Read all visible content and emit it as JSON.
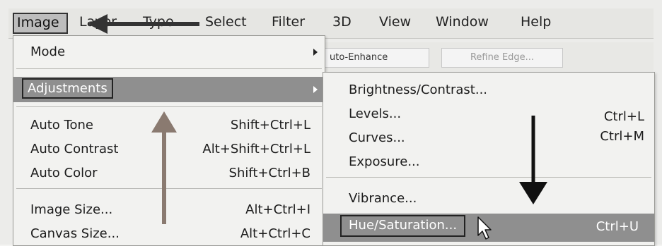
{
  "menubar": {
    "items": [
      "Image",
      "Layer",
      "Type",
      "Select",
      "Filter",
      "3D",
      "View",
      "Window",
      "Help"
    ]
  },
  "toolbar": {
    "auto_enhance": "uto-Enhance",
    "refine_edge": "Refine Edge..."
  },
  "image_menu": {
    "mode": "Mode",
    "adjustments": "Adjustments",
    "auto_tone": {
      "label": "Auto Tone",
      "shortcut": "Shift+Ctrl+L"
    },
    "auto_contrast": {
      "label": "Auto Contrast",
      "shortcut": "Alt+Shift+Ctrl+L"
    },
    "auto_color": {
      "label": "Auto Color",
      "shortcut": "Shift+Ctrl+B"
    },
    "image_size": {
      "label": "Image Size...",
      "shortcut": "Alt+Ctrl+I"
    },
    "canvas_size": {
      "label": "Canvas Size...",
      "shortcut": "Alt+Ctrl+C"
    }
  },
  "adjustments_menu": {
    "brightness_contrast": "Brightness/Contrast...",
    "levels": {
      "label": "Levels...",
      "shortcut": "Ctrl+L"
    },
    "curves": {
      "label": "Curves...",
      "shortcut": "Ctrl+M"
    },
    "exposure": "Exposure...",
    "vibrance": "Vibrance...",
    "hue_saturation": {
      "label": "Hue/Saturation...",
      "shortcut": "Ctrl+U"
    }
  },
  "colors": {
    "highlight": "#8f8f8f",
    "arrow": "#222222"
  }
}
